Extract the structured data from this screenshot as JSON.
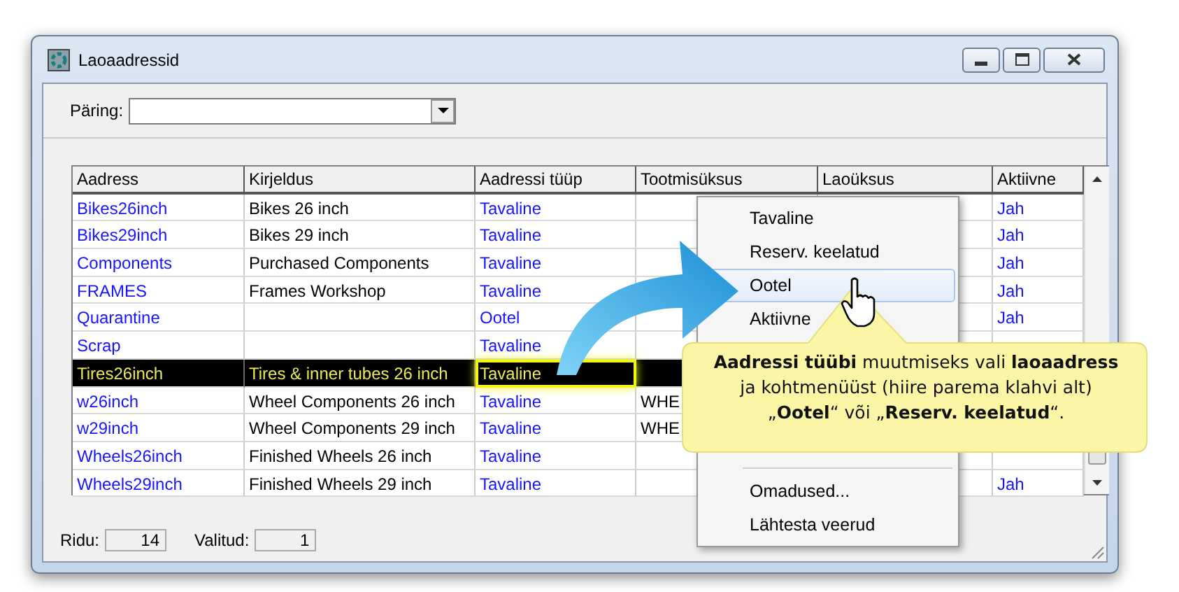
{
  "window": {
    "title": "Laoaadressid"
  },
  "query": {
    "label": "Päring:"
  },
  "table": {
    "columns": [
      {
        "label": "Aadress",
        "kind": "link"
      },
      {
        "label": "Kirjeldus",
        "kind": "text"
      },
      {
        "label": "Aadressi tüüp",
        "kind": "link"
      },
      {
        "label": "Tootmisüksus",
        "kind": "text"
      },
      {
        "label": "Laoüksus",
        "kind": "text"
      },
      {
        "label": "Aktiivne",
        "kind": "link"
      }
    ],
    "rows": [
      {
        "selected": false,
        "cells": [
          "Bikes26inch",
          "Bikes 26 inch",
          "Tavaline",
          "",
          "",
          "Jah"
        ]
      },
      {
        "selected": false,
        "cells": [
          "Bikes29inch",
          "Bikes 29 inch",
          "Tavaline",
          "",
          "",
          "Jah"
        ]
      },
      {
        "selected": false,
        "cells": [
          "Components",
          "Purchased Components",
          "Tavaline",
          "",
          "",
          "Jah"
        ]
      },
      {
        "selected": false,
        "cells": [
          "FRAMES",
          "Frames Workshop",
          "Tavaline",
          "",
          "",
          "Jah"
        ]
      },
      {
        "selected": false,
        "cells": [
          "Quarantine",
          "",
          "Ootel",
          "",
          "",
          "Jah"
        ]
      },
      {
        "selected": false,
        "cells": [
          "Scrap",
          "",
          "Tavaline",
          "",
          "",
          ""
        ]
      },
      {
        "selected": true,
        "cells": [
          "Tires26inch",
          "Tires & inner tubes 26 inch",
          "Tavaline",
          "",
          "",
          ""
        ],
        "focused": [
          false,
          false,
          true,
          false,
          false,
          false
        ]
      },
      {
        "selected": false,
        "cells": [
          "w26inch",
          "Wheel Components 26 inch",
          "Tavaline",
          "WHE",
          "",
          ""
        ]
      },
      {
        "selected": false,
        "cells": [
          "w29inch",
          "Wheel Components 29 inch",
          "Tavaline",
          "WHE",
          "",
          ""
        ]
      },
      {
        "selected": false,
        "cells": [
          "Wheels26inch",
          "Finished Wheels 26 inch",
          "Tavaline",
          "",
          "",
          ""
        ]
      },
      {
        "selected": false,
        "cells": [
          "Wheels29inch",
          "Finished Wheels 29 inch",
          "Tavaline",
          "",
          "",
          "Jah"
        ]
      }
    ]
  },
  "status_bar": {
    "rows_label": "Ridu:",
    "rows_value": "14",
    "selected_label": "Valitud:",
    "selected_value": "1"
  },
  "context_menu": {
    "groups": [
      [
        {
          "label": "Tavaline",
          "hovered": false
        },
        {
          "label": "Reserv. keelatud",
          "hovered": false
        },
        {
          "label": "Ootel",
          "hovered": true
        },
        {
          "label": "Aktiivne",
          "hovered": false
        }
      ],
      [
        {
          "label": "Omadused...",
          "hovered": false
        },
        {
          "label": "Lähtesta veerud",
          "hovered": false
        }
      ]
    ]
  },
  "callout": {
    "lines": [
      "**Aadressi tüübi** muutmiseks vali **laoaadress**",
      "ja kohtmenüüst (hiire parema klahvi alt)",
      "„**Ootel**“ või „**Reserv. keelatud**“."
    ]
  }
}
